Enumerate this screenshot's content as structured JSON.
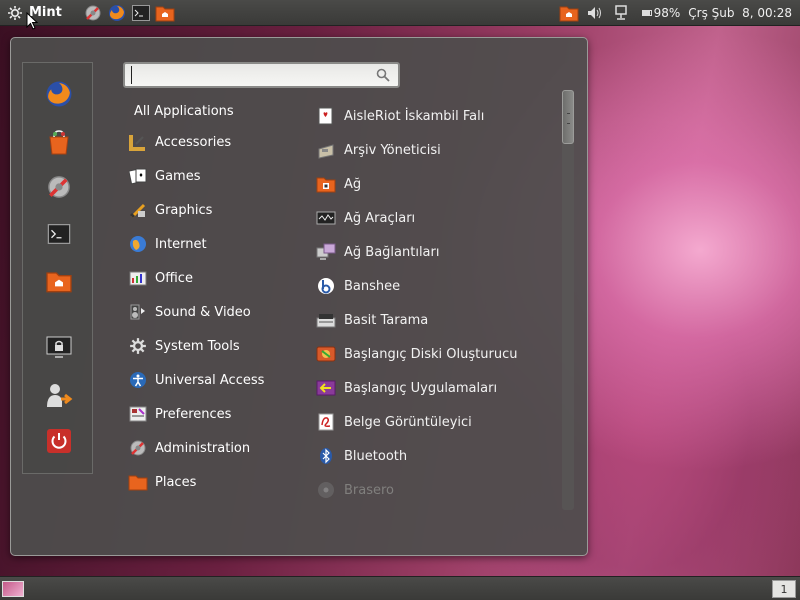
{
  "top_panel": {
    "menu_label": "Mint",
    "battery_text": "98%",
    "clock_text": "Çrş Şub  8, 00:28",
    "launchers": [
      "system-settings-icon",
      "firefox-icon",
      "terminal-icon",
      "home-folder-icon"
    ]
  },
  "search": {
    "placeholder": "",
    "value": ""
  },
  "categories": {
    "all_label": "All Applications",
    "items": [
      {
        "label": "Accessories",
        "icon": "accessories-icon"
      },
      {
        "label": "Games",
        "icon": "games-icon"
      },
      {
        "label": "Graphics",
        "icon": "graphics-icon"
      },
      {
        "label": "Internet",
        "icon": "internet-icon"
      },
      {
        "label": "Office",
        "icon": "office-icon"
      },
      {
        "label": "Sound & Video",
        "icon": "sound-video-icon"
      },
      {
        "label": "System Tools",
        "icon": "system-tools-icon"
      },
      {
        "label": "Universal Access",
        "icon": "universal-access-icon"
      },
      {
        "label": "Preferences",
        "icon": "preferences-icon"
      },
      {
        "label": "Administration",
        "icon": "administration-icon"
      },
      {
        "label": "Places",
        "icon": "places-icon"
      }
    ]
  },
  "apps": [
    {
      "label": "AisleRiot İskambil Falı",
      "icon": "cards-icon"
    },
    {
      "label": "Arşiv Yöneticisi",
      "icon": "archive-icon"
    },
    {
      "label": "Ağ",
      "icon": "network-icon"
    },
    {
      "label": "Ağ Araçları",
      "icon": "network-tools-icon"
    },
    {
      "label": "Ağ Bağlantıları",
      "icon": "network-connections-icon"
    },
    {
      "label": "Banshee",
      "icon": "banshee-icon"
    },
    {
      "label": "Basit Tarama",
      "icon": "scanner-icon"
    },
    {
      "label": "Başlangıç Diski Oluşturucu",
      "icon": "startup-disk-icon"
    },
    {
      "label": "Başlangıç Uygulamaları",
      "icon": "startup-apps-icon"
    },
    {
      "label": "Belge Görüntüleyici",
      "icon": "document-viewer-icon"
    },
    {
      "label": "Bluetooth",
      "icon": "bluetooth-icon"
    },
    {
      "label": "Brasero",
      "icon": "brasero-icon"
    }
  ],
  "favorites": [
    "firefox-icon",
    "software-manager-icon",
    "system-settings-icon",
    "terminal-icon",
    "home-folder-icon",
    "lock-screen-icon",
    "logout-icon",
    "shutdown-icon"
  ],
  "workspace": {
    "number": "1"
  },
  "colors": {
    "panel": "#3f3f3d",
    "menu_bg": "#4e4e4c",
    "text": "#ffffff",
    "shutdown_red": "#c8302a",
    "folder_orange": "#e8641e"
  }
}
